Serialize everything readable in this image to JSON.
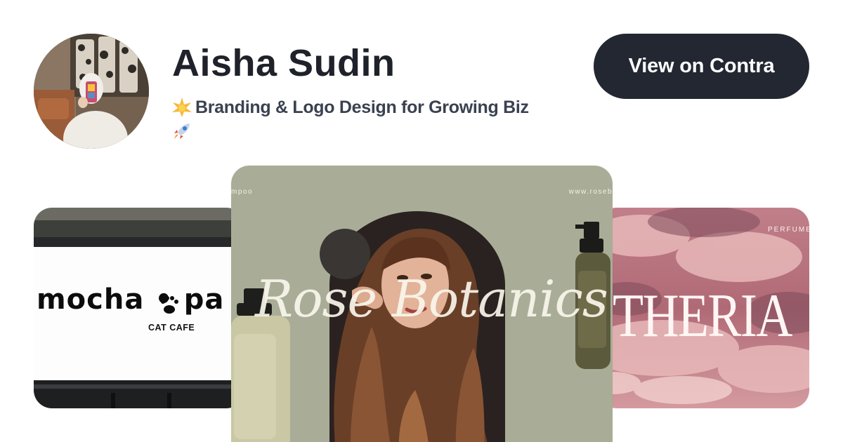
{
  "profile": {
    "name": "Aisha Sudin",
    "tagline": "Branding & Logo Design for Growing Biz",
    "tagline_emojis": [
      "sparkle-star-icon",
      "rocket-icon"
    ]
  },
  "actions": {
    "view_button_label": "View on Contra"
  },
  "gallery": {
    "left": {
      "title": "mocha • pa",
      "subtitle": "CAT CAFE"
    },
    "center": {
      "top_left": "mpoo",
      "top_right": "www.roseb",
      "script_title": "Rose Botanics"
    },
    "right": {
      "top_label": "PERFUME",
      "title": "THERIA"
    }
  },
  "colors": {
    "button_bg": "#222731",
    "name_text": "#1f222a",
    "tagline_text": "#3a4150",
    "center_bg": "#a9ad97"
  }
}
